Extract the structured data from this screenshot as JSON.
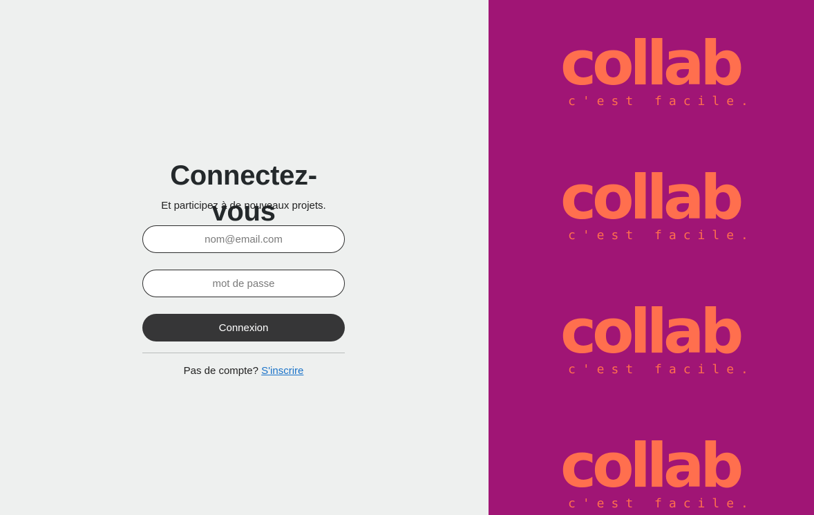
{
  "login": {
    "title": "Connectez-vous",
    "subtitle": "Et participez à de nouveaux projets.",
    "email_placeholder": "nom@email.com",
    "password_placeholder": "mot de passe",
    "submit_label": "Connexion",
    "signup_prompt": "Pas de compte?",
    "signup_link": "S'inscrire"
  },
  "brand": {
    "logo_word": "collab",
    "tagline": "c'est facile.",
    "repeat_count": 4,
    "colors": {
      "panel_bg": "#a01575",
      "logo": "#ff6f4e",
      "page_bg": "#eef0ef",
      "button_bg": "#363637",
      "link": "#1a73c9"
    }
  }
}
